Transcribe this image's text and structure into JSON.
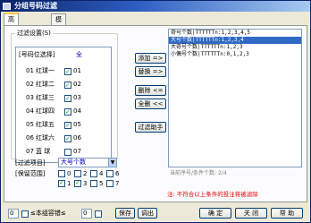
{
  "window": {
    "title": "分组号码过滤"
  },
  "tabs": [
    {
      "label": "高级过滤设置"
    },
    {
      "label": "模拟过滤"
    }
  ],
  "filter_settings": {
    "legend": "过滤设置(S)",
    "grid_header": "[号码位选择]",
    "all_label": "全",
    "rows": [
      {
        "num": "01",
        "name": "红球一",
        "checked": true,
        "cb_label": "01"
      },
      {
        "num": "02",
        "name": "红球二",
        "checked": true,
        "cb_label": "02"
      },
      {
        "num": "03",
        "name": "红球三",
        "checked": true,
        "cb_label": "03"
      },
      {
        "num": "04",
        "name": "红球四",
        "checked": true,
        "cb_label": "04"
      },
      {
        "num": "05",
        "name": "红球五",
        "checked": true,
        "cb_label": "05"
      },
      {
        "num": "06",
        "name": "红球六",
        "checked": true,
        "cb_label": "06"
      },
      {
        "num": "07",
        "name": "蓝  球",
        "checked": false,
        "cb_label": "07"
      }
    ]
  },
  "filter_item": {
    "label": "[过滤项目]",
    "value": "大号个数"
  },
  "retain_range": {
    "label": "[保留范围]",
    "checks": [
      {
        "label": "0",
        "checked": false
      },
      {
        "label": "2",
        "checked": false
      },
      {
        "label": "4",
        "checked": false
      },
      {
        "label": "6",
        "checked": false
      },
      {
        "label": "1",
        "checked": true
      },
      {
        "label": "3",
        "checked": true
      },
      {
        "label": "5",
        "checked": false
      },
      {
        "label": "7",
        "checked": false
      }
    ]
  },
  "actions": {
    "add": "添加 =>",
    "replace": "替换 =>",
    "delete": "删除 <=",
    "clear_all": "全删 <<",
    "helper": "过滤助手"
  },
  "condition_list": {
    "items": [
      {
        "text": "奇号个数|TTTTTTn:1,2,3,4,5",
        "selected": false
      },
      {
        "text": "大号个数|TTTTTTn:1,2,3,4",
        "selected": true
      },
      {
        "text": "大奇号个数|TTTTTTn:1,2,3",
        "selected": false
      },
      {
        "text": "小偶号个数|TTTTTTn:0,1,2,3",
        "selected": false
      }
    ],
    "status": "当前序号/条件个数: 2/4"
  },
  "note": "注: 不符合以上条件的投注将被滤除",
  "bottom": {
    "error_value": "0",
    "error_label": "≤本组容错≤",
    "error_value2": "0",
    "save": "保存",
    "load": "调出",
    "ok": "确 定",
    "close": "关 闭",
    "help": "帮 助"
  }
}
